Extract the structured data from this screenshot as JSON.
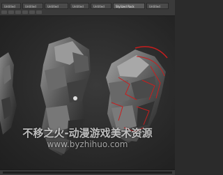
{
  "app": {
    "tabs": [
      {
        "label": "Untitled",
        "active": false
      },
      {
        "label": "Untitled",
        "active": false
      },
      {
        "label": "Untitled",
        "active": false
      },
      {
        "label": "Untitled",
        "active": false
      },
      {
        "label": "Untitled",
        "active": false
      },
      {
        "label": "Stylized Rock",
        "active": true
      },
      {
        "label": "Untitled",
        "active": false
      }
    ]
  },
  "viewport": {
    "object_icons": [
      "rock-sculpt-left",
      "rock-sculpt-center",
      "rock-sculpt-right"
    ],
    "accent_color": "#c81e1e"
  },
  "timeline": {
    "progress": 0.0
  },
  "watermark": {
    "line1": "不移之火-动漫游戏美术资源",
    "line2": "www.byzhihuo.com"
  }
}
